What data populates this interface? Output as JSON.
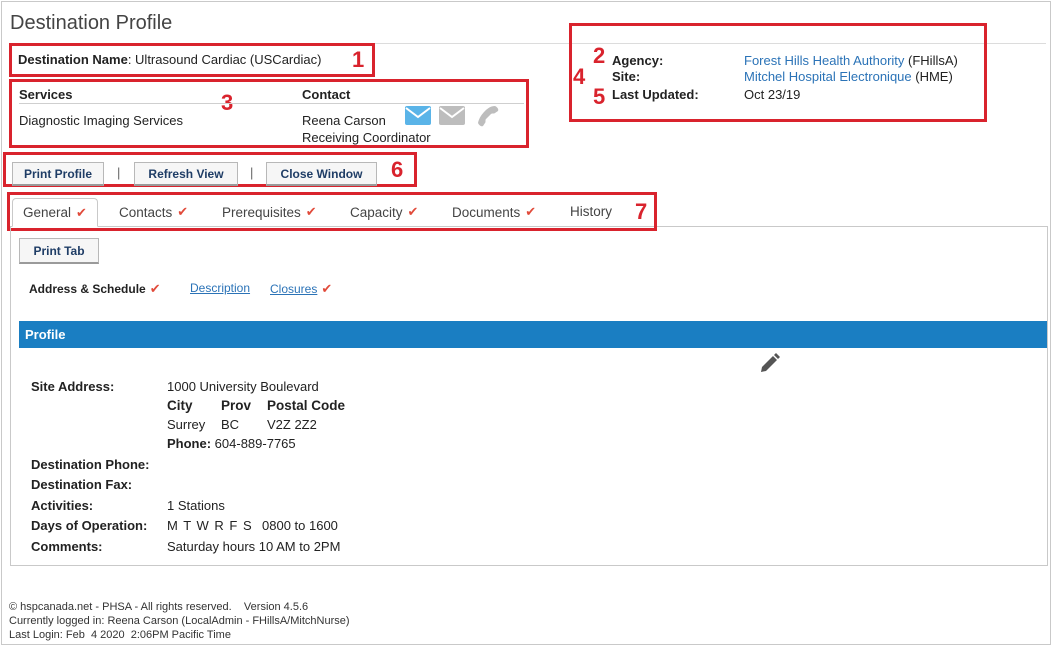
{
  "page": {
    "title": "Destination Profile"
  },
  "destination": {
    "name_label": "Destination Name",
    "name_value": ": Ultrasound Cardiac (USCardiac)"
  },
  "agency": {
    "agency_label": "Agency:",
    "agency_link": "Forest Hills Health Authority",
    "agency_code": " (FHillsA)",
    "site_label": "Site:",
    "site_link": "Mitchel Hospital Electronique",
    "site_code": " (HME)",
    "updated_label": "Last Updated:",
    "updated_value": "Oct 23/19"
  },
  "services": {
    "services_header": "Services",
    "contact_header": "Contact",
    "service_value": "Diagnostic Imaging Services",
    "contact_name": "Reena Carson",
    "contact_role": "Receiving Coordinator",
    "icons": [
      "email-icon",
      "message-icon",
      "phone-icon"
    ],
    "icon_colors": {
      "email": "#5ab4e8",
      "message": "#bdbdbd",
      "phone": "#bdbdbd"
    }
  },
  "toolbar": {
    "print_profile": "Print Profile",
    "sep1": "|",
    "refresh_view": "Refresh View",
    "sep2": "|",
    "close_window": "Close Window"
  },
  "tabs": [
    {
      "label": "General",
      "checked": true,
      "active": true
    },
    {
      "label": "Contacts",
      "checked": true
    },
    {
      "label": "Prerequisites",
      "checked": true
    },
    {
      "label": "Capacity",
      "checked": true
    },
    {
      "label": "Documents",
      "checked": true
    },
    {
      "label": "History",
      "checked": false
    }
  ],
  "check_glyph": "✔",
  "print_tab": "Print Tab",
  "subnav": {
    "address_schedule": "Address & Schedule",
    "description": "Description",
    "closures": "Closures"
  },
  "profile": {
    "header": "Profile",
    "site_address_label": "Site Address:",
    "site_address_value": "1000 University Boulevard",
    "city_label": "City",
    "prov_label": "Prov",
    "postal_label": "Postal Code",
    "city_value": "Surrey",
    "prov_value": "BC",
    "postal_value": "V2Z 2Z2",
    "phone_label": "Phone:",
    "phone_value": " 604-889-7765",
    "dest_phone_label": "Destination Phone:",
    "dest_fax_label": "Destination Fax:",
    "activities_label": "Activities:",
    "activities_value": "1 Stations",
    "days_label": "Days of Operation:",
    "days_value": "M T W R F S",
    "hours_value": "0800 to 1600",
    "comments_label": "Comments:",
    "comments_value": "Saturday hours 10 AM to 2PM"
  },
  "footer": {
    "line1": "© hspcanada.net - PHSA - All rights reserved.    Version 4.5.6",
    "line2": "Currently logged in: Reena Carson (LocalAdmin - FHillsA/MitchNurse)",
    "line3": "Last Login: Feb  4 2020  2:06PM Pacific Time"
  },
  "annotations": [
    "1",
    "2",
    "3",
    "4",
    "5",
    "6",
    "7"
  ],
  "colors": {
    "annotation_red": "#d9232d",
    "profile_blue": "#1a7ec2",
    "link_blue": "#2b73b7",
    "check_red": "#e14a3a"
  }
}
